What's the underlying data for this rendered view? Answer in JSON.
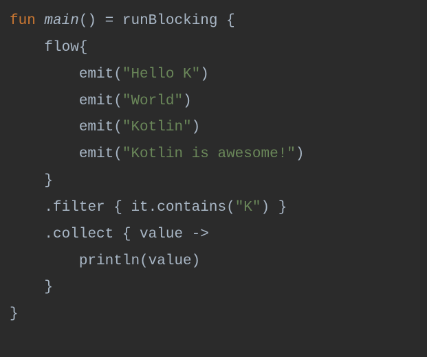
{
  "code": {
    "line1": {
      "keyword": "fun",
      "funcName": "main",
      "parens": "()",
      "equals": " = ",
      "call": "runBlocking",
      "brace": " {"
    },
    "line2": {
      "indent": "    ",
      "call": "flow",
      "brace": "{"
    },
    "line3": {
      "indent": "        ",
      "call": "emit(",
      "string": "\"Hello K\"",
      "close": ")"
    },
    "line4": {
      "indent": "        ",
      "call": "emit(",
      "string": "\"World\"",
      "close": ")"
    },
    "line5": {
      "indent": "        ",
      "call": "emit(",
      "string": "\"Kotlin\"",
      "close": ")"
    },
    "line6": {
      "indent": "        ",
      "call": "emit(",
      "string": "\"Kotlin is awesome!\"",
      "close": ")"
    },
    "line7": {
      "indent": "    ",
      "brace": "}"
    },
    "line8": {
      "indent": "    ",
      "dot": ".",
      "call": "filter { it.contains(",
      "string": "\"K\"",
      "close": ") }"
    },
    "line9": {
      "indent": "    ",
      "dot": ".",
      "call": "collect { value ->"
    },
    "line10": {
      "indent": "        ",
      "call": "println(value)"
    },
    "line11": {
      "indent": "    ",
      "brace": "}"
    },
    "line12": {
      "brace": "}"
    }
  }
}
